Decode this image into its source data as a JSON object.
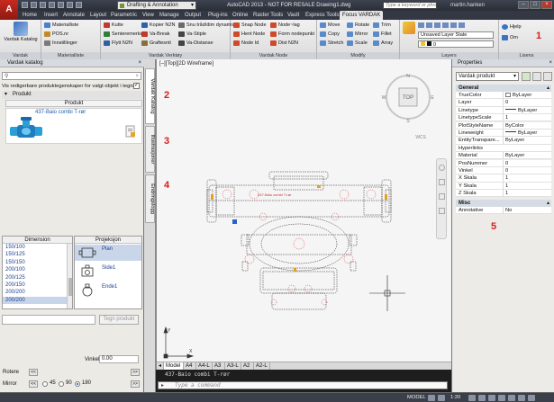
{
  "titlebar": {
    "app_button": "A",
    "workspace": "Drafting & Annotation",
    "title": "AutoCAD 2013 - NOT FOR RESALE   Drawing1.dwg",
    "search_placeholder": "Type a keyword or phrase",
    "user": "martin.hanken"
  },
  "menu": {
    "tabs": [
      "Home",
      "Insert",
      "Annotate",
      "Layout",
      "Parametric",
      "View",
      "Manage",
      "Output",
      "Plug-ins",
      "Online",
      "Raster Tools",
      "Vault",
      "Express Tools",
      "Focus VARDAK"
    ],
    "active": "Focus VARDAK"
  },
  "ribbon": {
    "panels": {
      "vardak": "Vardak",
      "materialliste": "Materialliste",
      "vardak_verktoy": "Vardak Verktøy",
      "vardak_node": "Vardak Node",
      "modify": "Modify",
      "layers": "Layers",
      "lisens": "Lisens"
    },
    "vardak_katalog": "Vardak Katalog",
    "materialliste": [
      "Materialliste",
      "POS.nr",
      "Innstillinger"
    ],
    "verktoy_col1": [
      "Kutte",
      "Senteremerke",
      "Flytt N2N"
    ],
    "verktoy_col2": [
      "Kopier N2N",
      "Va-Break",
      "Graftesnit"
    ],
    "verktoy_col3": [
      "Snu tråd/dim dynamisk",
      "Va-Stiple",
      "Va-Distanse"
    ],
    "node_col1": [
      "Snap Node",
      "Hent Node",
      "Node Id"
    ],
    "node_col2": [
      "Node~lag",
      "Form nodepunkt",
      "Dist N2N"
    ],
    "modify_col1": [
      "Move",
      "Copy",
      "Stretch"
    ],
    "modify_col2": [
      "Rotate",
      "Mirror",
      "Scale"
    ],
    "modify_col3": [
      "Trim",
      "Fillet",
      "Array"
    ],
    "layer_state": "Unsaved Layer State",
    "layer_current": "0",
    "help": "Hjelp",
    "about": "Om"
  },
  "palette": {
    "title": "Vardak katalog",
    "search_placeholder": "",
    "vis_label": "Vis redigerbare produktegenskaper for valgt objekt i tegning",
    "group": "Produkt",
    "column": "Produkt",
    "item": "437-Baio combi T-rør",
    "dim_header": "Dimension",
    "dimensions": [
      "150/100",
      "150/125",
      "150/150",
      "200/100",
      "200/125",
      "200/150",
      "200/200"
    ],
    "dim_selected": "200/200",
    "proj_header": "Projeksjon",
    "projections": [
      "Plan",
      "Side1",
      "Ende1"
    ],
    "tegn_button": "Tegn produkt",
    "vinkel_label": "Vinkel",
    "vinkel_value": "0.00",
    "rotere_label": "Rotere",
    "speil_label": "Mirror",
    "rot_opts": [
      "45",
      "90",
      "180"
    ],
    "rot_selected": "180",
    "btn_left": "<<",
    "btn_right": ">>"
  },
  "vtabs": [
    "Vardak Katalog",
    "Illustrasjoner",
    "Endringslogg"
  ],
  "canvas": {
    "view_label": "[–][Top][2D Wireframe]",
    "viewcube_top": "TOP",
    "viewcube_n": "N",
    "viewcube_s": "S",
    "viewcube_e": "E",
    "viewcube_w": "W",
    "wcs": "WCS",
    "layout_tabs": [
      "Model",
      "A4",
      "A4-L",
      "A3",
      "A3-L",
      "A2",
      "A2-L"
    ],
    "red_label": "437-Baio combi T-rør"
  },
  "command": {
    "history": "437-Baio combi T-rør",
    "placeholder": "Type a command"
  },
  "status": {
    "model": "MODEL",
    "scale": "1:20"
  },
  "properties": {
    "title": "Properties",
    "selected": "Vardak produkt",
    "general": "General",
    "misc": "Misc",
    "rows": [
      {
        "k": "TrueColor",
        "v": "ByLayer",
        "sw": true
      },
      {
        "k": "Layer",
        "v": "0"
      },
      {
        "k": "Linetype",
        "v": "ByLayer",
        "ln": true
      },
      {
        "k": "LinetypeScale",
        "v": "1"
      },
      {
        "k": "PlotStyleName",
        "v": "ByColor"
      },
      {
        "k": "Lineweight",
        "v": "ByLayer",
        "ln": true
      },
      {
        "k": "EntityTranspare...",
        "v": "ByLayer"
      },
      {
        "k": "Hyperlinks",
        "v": ""
      },
      {
        "k": "Material",
        "v": "ByLayer"
      },
      {
        "k": "PosNummer",
        "v": "0"
      },
      {
        "k": "Vinkel",
        "v": "0"
      },
      {
        "k": "X Skala",
        "v": "1"
      },
      {
        "k": "Y Skala",
        "v": "1"
      },
      {
        "k": "Z Skala",
        "v": "1"
      }
    ],
    "misc_rows": [
      {
        "k": "Annotative",
        "v": "No"
      }
    ]
  },
  "annotations": [
    "1",
    "2",
    "3",
    "4",
    "5"
  ],
  "colors": {
    "accent": "#1a5bb5",
    "annotation": "#d41f1f",
    "drawing_red": "#d0312d"
  }
}
